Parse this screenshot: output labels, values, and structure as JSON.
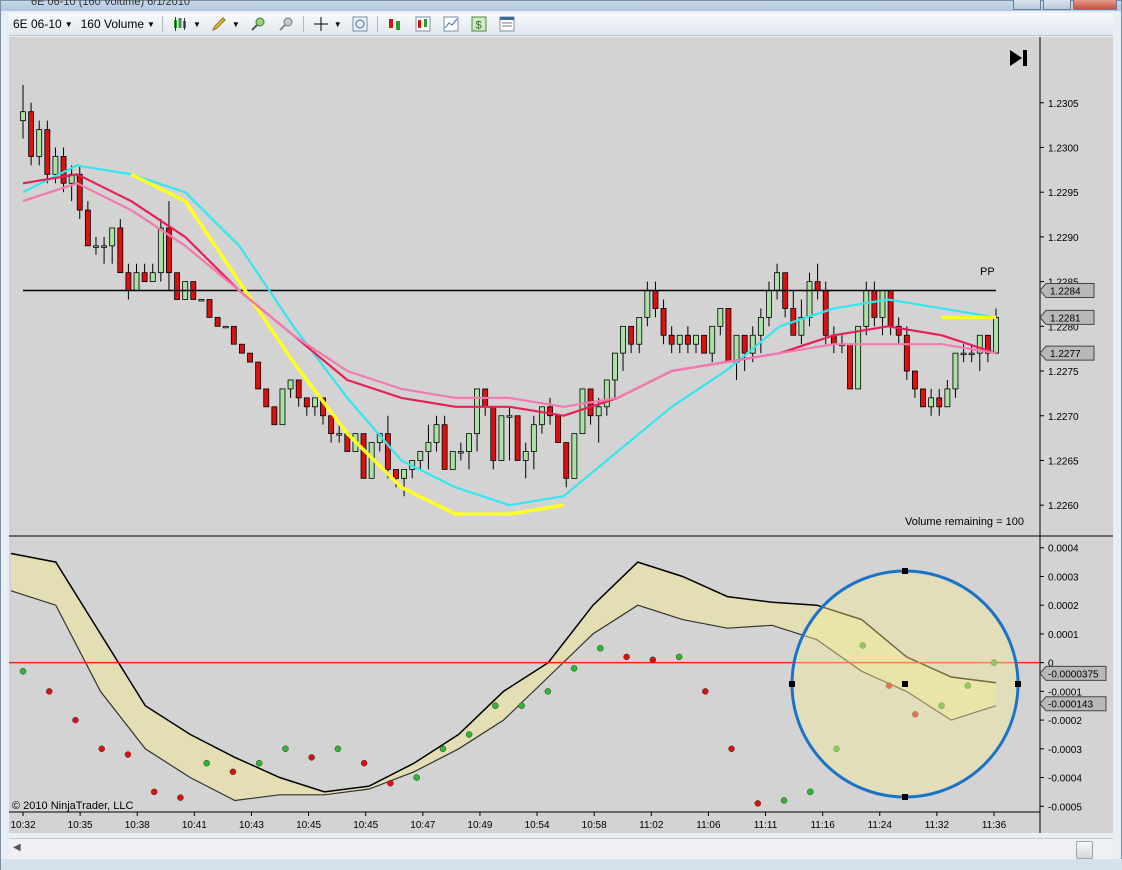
{
  "window": {
    "title": "6E 06-10 (160 Volume) 6/1/2010"
  },
  "toolbar": {
    "instrument": "6E 06-10",
    "interval": "160 Volume"
  },
  "price_panel": {
    "y_ticks": [
      "1.2305",
      "1.2300",
      "1.2295",
      "1.2290",
      "1.2285",
      "1.2280",
      "1.2275",
      "1.2270",
      "1.2265",
      "1.2260"
    ],
    "pp_label": "PP",
    "price_markers": [
      "1.2284",
      "1.2281",
      "1.2277"
    ],
    "volume_remaining": "Volume remaining = 100"
  },
  "indicator_panel": {
    "y_ticks": [
      "0.0004",
      "0.0003",
      "0.0002",
      "0.0001",
      "0",
      "-0.0001",
      "-0.0002",
      "-0.0003",
      "-0.0004",
      "-0.0005"
    ],
    "value_markers": [
      "-0.0000375",
      "-0.000143"
    ],
    "copyright": "© 2010 NinjaTrader, LLC"
  },
  "x_axis": {
    "ticks": [
      "10:32",
      "10:35",
      "10:38",
      "10:41",
      "10:43",
      "10:45",
      "10:45",
      "10:47",
      "10:49",
      "10:54",
      "10:58",
      "11:02",
      "11:06",
      "11:11",
      "11:16",
      "11:24",
      "11:32",
      "11:36"
    ]
  },
  "chart_data": {
    "type": "candlestick",
    "instrument": "6E 06-10",
    "bar_type": "160 Volume",
    "pivot_pp": 1.2284,
    "price_ylim": [
      1.2257,
      1.2309
    ],
    "candles": [
      [
        1.2303,
        1.2307,
        1.2301,
        1.2304
      ],
      [
        1.2304,
        1.2305,
        1.2298,
        1.2299
      ],
      [
        1.2299,
        1.2303,
        1.2298,
        1.2302
      ],
      [
        1.2302,
        1.2303,
        1.2296,
        1.2297
      ],
      [
        1.2297,
        1.23,
        1.2296,
        1.2299
      ],
      [
        1.2299,
        1.23,
        1.2295,
        1.2296
      ],
      [
        1.2296,
        1.2298,
        1.2294,
        1.2297
      ],
      [
        1.2297,
        1.2298,
        1.2292,
        1.2293
      ],
      [
        1.2293,
        1.2294,
        1.2289,
        1.2289
      ],
      [
        1.2289,
        1.229,
        1.2288,
        1.2289
      ],
      [
        1.2289,
        1.229,
        1.2287,
        1.2289
      ],
      [
        1.2289,
        1.2291,
        1.2287,
        1.2291
      ],
      [
        1.2291,
        1.2292,
        1.2286,
        1.2286
      ],
      [
        1.2286,
        1.2287,
        1.2283,
        1.2284
      ],
      [
        1.2284,
        1.2287,
        1.2284,
        1.2286
      ],
      [
        1.2286,
        1.2287,
        1.2285,
        1.2285
      ],
      [
        1.2285,
        1.2287,
        1.2285,
        1.2286
      ],
      [
        1.2286,
        1.2292,
        1.2285,
        1.2291
      ],
      [
        1.2291,
        1.2294,
        1.2284,
        1.2286
      ],
      [
        1.2286,
        1.2286,
        1.2283,
        1.2283
      ],
      [
        1.2283,
        1.2285,
        1.2283,
        1.2285
      ],
      [
        1.2285,
        1.2285,
        1.2283,
        1.2283
      ],
      [
        1.2283,
        1.2283,
        1.2283,
        1.2283
      ],
      [
        1.2283,
        1.2283,
        1.2281,
        1.2281
      ],
      [
        1.2281,
        1.2281,
        1.228,
        1.228
      ],
      [
        1.228,
        1.228,
        1.228,
        1.228
      ],
      [
        1.228,
        1.228,
        1.2278,
        1.2278
      ],
      [
        1.2278,
        1.2278,
        1.2277,
        1.2277
      ],
      [
        1.2277,
        1.2277,
        1.2276,
        1.2276
      ],
      [
        1.2276,
        1.2276,
        1.2273,
        1.2273
      ],
      [
        1.2273,
        1.2273,
        1.2271,
        1.2271
      ],
      [
        1.2271,
        1.2271,
        1.2269,
        1.2269
      ],
      [
        1.2269,
        1.2273,
        1.2269,
        1.2273
      ],
      [
        1.2273,
        1.2274,
        1.2272,
        1.2274
      ],
      [
        1.2274,
        1.2274,
        1.2271,
        1.2272
      ],
      [
        1.2272,
        1.2272,
        1.227,
        1.2271
      ],
      [
        1.2271,
        1.2272,
        1.227,
        1.2272
      ],
      [
        1.2272,
        1.2272,
        1.2269,
        1.227
      ],
      [
        1.227,
        1.227,
        1.2267,
        1.2268
      ],
      [
        1.2268,
        1.2269,
        1.2267,
        1.2268
      ],
      [
        1.2268,
        1.2268,
        1.2266,
        1.2266
      ],
      [
        1.2266,
        1.2268,
        1.2266,
        1.2268
      ],
      [
        1.2268,
        1.2268,
        1.2263,
        1.2263
      ],
      [
        1.2263,
        1.2267,
        1.2263,
        1.2267
      ],
      [
        1.2267,
        1.2268,
        1.2266,
        1.2268
      ],
      [
        1.2268,
        1.227,
        1.2263,
        1.2264
      ],
      [
        1.2264,
        1.2264,
        1.2262,
        1.2263
      ],
      [
        1.2263,
        1.2264,
        1.2261,
        1.2264
      ],
      [
        1.2264,
        1.2265,
        1.2263,
        1.2265
      ],
      [
        1.2265,
        1.2266,
        1.2264,
        1.2266
      ],
      [
        1.2266,
        1.2269,
        1.2264,
        1.2267
      ],
      [
        1.2267,
        1.227,
        1.2266,
        1.2269
      ],
      [
        1.2269,
        1.227,
        1.2264,
        1.2264
      ],
      [
        1.2264,
        1.2266,
        1.2264,
        1.2266
      ],
      [
        1.2266,
        1.2267,
        1.2265,
        1.2266
      ],
      [
        1.2266,
        1.2268,
        1.2264,
        1.2268
      ],
      [
        1.2268,
        1.2273,
        1.2266,
        1.2273
      ],
      [
        1.2273,
        1.2273,
        1.227,
        1.2271
      ],
      [
        1.2271,
        1.2271,
        1.2264,
        1.2265
      ],
      [
        1.2265,
        1.227,
        1.2265,
        1.227
      ],
      [
        1.227,
        1.2271,
        1.2265,
        1.227
      ],
      [
        1.227,
        1.227,
        1.2265,
        1.2265
      ],
      [
        1.2265,
        1.2267,
        1.2263,
        1.2266
      ],
      [
        1.2266,
        1.227,
        1.2264,
        1.2269
      ],
      [
        1.2269,
        1.2271,
        1.2268,
        1.2271
      ],
      [
        1.2271,
        1.2272,
        1.2269,
        1.227
      ],
      [
        1.227,
        1.227,
        1.2267,
        1.2267
      ],
      [
        1.2267,
        1.2267,
        1.2262,
        1.2263
      ],
      [
        1.2263,
        1.2268,
        1.2263,
        1.2268
      ],
      [
        1.2268,
        1.2273,
        1.2268,
        1.2273
      ],
      [
        1.2273,
        1.2273,
        1.2269,
        1.227
      ],
      [
        1.227,
        1.2272,
        1.2267,
        1.2271
      ],
      [
        1.2271,
        1.2274,
        1.227,
        1.2274
      ],
      [
        1.2274,
        1.2277,
        1.2272,
        1.2277
      ],
      [
        1.2277,
        1.228,
        1.2275,
        1.228
      ],
      [
        1.228,
        1.228,
        1.2277,
        1.2278
      ],
      [
        1.2278,
        1.2281,
        1.2277,
        1.2281
      ],
      [
        1.2281,
        1.2285,
        1.228,
        1.2284
      ],
      [
        1.2284,
        1.2285,
        1.2281,
        1.2282
      ],
      [
        1.2282,
        1.2283,
        1.2278,
        1.2279
      ],
      [
        1.2279,
        1.228,
        1.2277,
        1.2278
      ],
      [
        1.2278,
        1.2279,
        1.2277,
        1.2279
      ],
      [
        1.2279,
        1.228,
        1.2277,
        1.2278
      ],
      [
        1.2278,
        1.2279,
        1.2277,
        1.2279
      ],
      [
        1.2279,
        1.2279,
        1.2277,
        1.2277
      ],
      [
        1.2277,
        1.228,
        1.2276,
        1.228
      ],
      [
        1.228,
        1.2282,
        1.2279,
        1.2282
      ],
      [
        1.2282,
        1.2282,
        1.2276,
        1.2276
      ],
      [
        1.2276,
        1.2279,
        1.2274,
        1.2279
      ],
      [
        1.2279,
        1.2279,
        1.2275,
        1.2277
      ],
      [
        1.2277,
        1.228,
        1.2276,
        1.2279
      ],
      [
        1.2279,
        1.2282,
        1.2277,
        1.2281
      ],
      [
        1.2281,
        1.2285,
        1.228,
        1.2284
      ],
      [
        1.2284,
        1.2287,
        1.2283,
        1.2286
      ],
      [
        1.2286,
        1.2286,
        1.2281,
        1.2282
      ],
      [
        1.2282,
        1.2284,
        1.2279,
        1.2279
      ],
      [
        1.2279,
        1.2283,
        1.2278,
        1.2281
      ],
      [
        1.2281,
        1.2286,
        1.228,
        1.2285
      ],
      [
        1.2285,
        1.2287,
        1.2283,
        1.2284
      ],
      [
        1.2284,
        1.2285,
        1.2278,
        1.2279
      ],
      [
        1.2279,
        1.228,
        1.2277,
        1.2278
      ],
      [
        1.2278,
        1.2279,
        1.2277,
        1.2278
      ],
      [
        1.2278,
        1.2278,
        1.2273,
        1.2273
      ],
      [
        1.2273,
        1.228,
        1.2273,
        1.228
      ],
      [
        1.228,
        1.2285,
        1.2279,
        1.2284
      ],
      [
        1.2284,
        1.2285,
        1.228,
        1.2281
      ],
      [
        1.2281,
        1.2284,
        1.2279,
        1.2284
      ],
      [
        1.2284,
        1.2284,
        1.2279,
        1.228
      ],
      [
        1.228,
        1.2281,
        1.2278,
        1.2279
      ],
      [
        1.2279,
        1.228,
        1.2274,
        1.2275
      ],
      [
        1.2275,
        1.2275,
        1.2272,
        1.2273
      ],
      [
        1.2273,
        1.2273,
        1.2271,
        1.2271
      ],
      [
        1.2271,
        1.2273,
        1.227,
        1.2272
      ],
      [
        1.2272,
        1.2273,
        1.227,
        1.2271
      ],
      [
        1.2271,
        1.2274,
        1.2271,
        1.2273
      ],
      [
        1.2273,
        1.2277,
        1.2272,
        1.2277
      ],
      [
        1.2277,
        1.2278,
        1.2276,
        1.2277
      ],
      [
        1.2277,
        1.2278,
        1.2276,
        1.2277
      ],
      [
        1.2277,
        1.2279,
        1.2275,
        1.2279
      ],
      [
        1.2279,
        1.2279,
        1.2276,
        1.2277
      ],
      [
        1.2277,
        1.2282,
        1.2277,
        1.2281
      ]
    ],
    "ma_series": [
      {
        "color": "#33e6f0",
        "values": [
          1.2295,
          1.2298,
          1.2297,
          1.2295,
          1.2289,
          1.228,
          1.2272,
          1.2265,
          1.2262,
          1.226,
          1.2261,
          1.2266,
          1.2271,
          1.2275,
          1.228,
          1.2282,
          1.2283,
          1.2282,
          1.2281
        ]
      },
      {
        "color": "#ffff22",
        "values": [
          null,
          null,
          1.2297,
          1.2294,
          1.2285,
          1.2276,
          1.2268,
          1.2262,
          1.2259,
          1.2259,
          1.226,
          null,
          null,
          null,
          null,
          null,
          null,
          1.2281,
          1.2281
        ]
      },
      {
        "color": "#e8205a",
        "values": [
          1.2296,
          1.2297,
          1.2294,
          1.229,
          1.2284,
          1.2279,
          1.2274,
          1.2272,
          1.2271,
          1.2271,
          1.227,
          1.2272,
          1.2275,
          1.2276,
          1.2277,
          1.2279,
          1.228,
          1.2279,
          1.2277
        ]
      },
      {
        "color": "#f37ab0",
        "values": [
          1.2294,
          1.2296,
          1.2293,
          1.2289,
          1.2284,
          1.2279,
          1.2275,
          1.2273,
          1.2272,
          1.2272,
          1.2271,
          1.2272,
          1.2275,
          1.2276,
          1.2277,
          1.2278,
          1.2278,
          1.2278,
          1.2277
        ]
      }
    ],
    "indicator_ylim": [
      -0.00052,
      0.00042
    ],
    "indicator_upper": [
      0.00038,
      0.00035,
      0.0001,
      -0.00015,
      -0.00025,
      -0.00033,
      -0.0004,
      -0.00045,
      -0.00043,
      -0.00035,
      -0.00025,
      -0.0001,
      0.0,
      0.0002,
      0.00035,
      0.0003,
      0.00023,
      0.00021,
      0.0002,
      0.00015,
      2e-05,
      -5e-05,
      -7e-05
    ],
    "indicator_lower": [
      0.00025,
      0.0002,
      -0.0001,
      -0.0003,
      -0.0004,
      -0.00048,
      -0.00046,
      -0.00046,
      -0.00044,
      -0.00038,
      -0.0003,
      -0.0002,
      -5e-05,
      0.0001,
      0.0002,
      0.00015,
      0.00012,
      0.00013,
      8e-05,
      -3e-05,
      -0.0001,
      -0.0002,
      -0.00015
    ],
    "indicator_dots": [
      -3e-05,
      -0.0001,
      -0.0002,
      -0.0003,
      -0.00032,
      -0.00045,
      -0.00047,
      -0.00035,
      -0.00038,
      -0.00035,
      -0.0003,
      -0.00033,
      -0.0003,
      -0.00035,
      -0.00042,
      -0.0004,
      -0.0003,
      -0.00025,
      -0.00015,
      -0.00015,
      -0.0001,
      -2e-05,
      5e-05,
      2e-05,
      1e-05,
      2e-05,
      -0.0001,
      -0.0003,
      -0.00049,
      -0.00048,
      -0.00045,
      -0.0003,
      6e-05,
      -8e-05,
      -0.00018,
      -0.00015,
      -8e-05,
      0.0
    ],
    "zero_line_color": "#ff2a00"
  },
  "colors": {
    "chart_bg": "#d3d3d3",
    "up_candle": "#a9e2a4",
    "down_candle": "#dd1010",
    "pp_line": "#000000",
    "circle": "#1a73c8",
    "band_fill": "#e6dfae"
  },
  "icons": [
    "candlestick-style-icon",
    "pencil-icon",
    "zoom-in-icon",
    "zoom-out-icon",
    "crosshair-icon",
    "magnifier-icon",
    "strategy-icon",
    "indicators-icon",
    "chart-icon",
    "dollar-icon",
    "properties-icon",
    "play-end-icon"
  ]
}
